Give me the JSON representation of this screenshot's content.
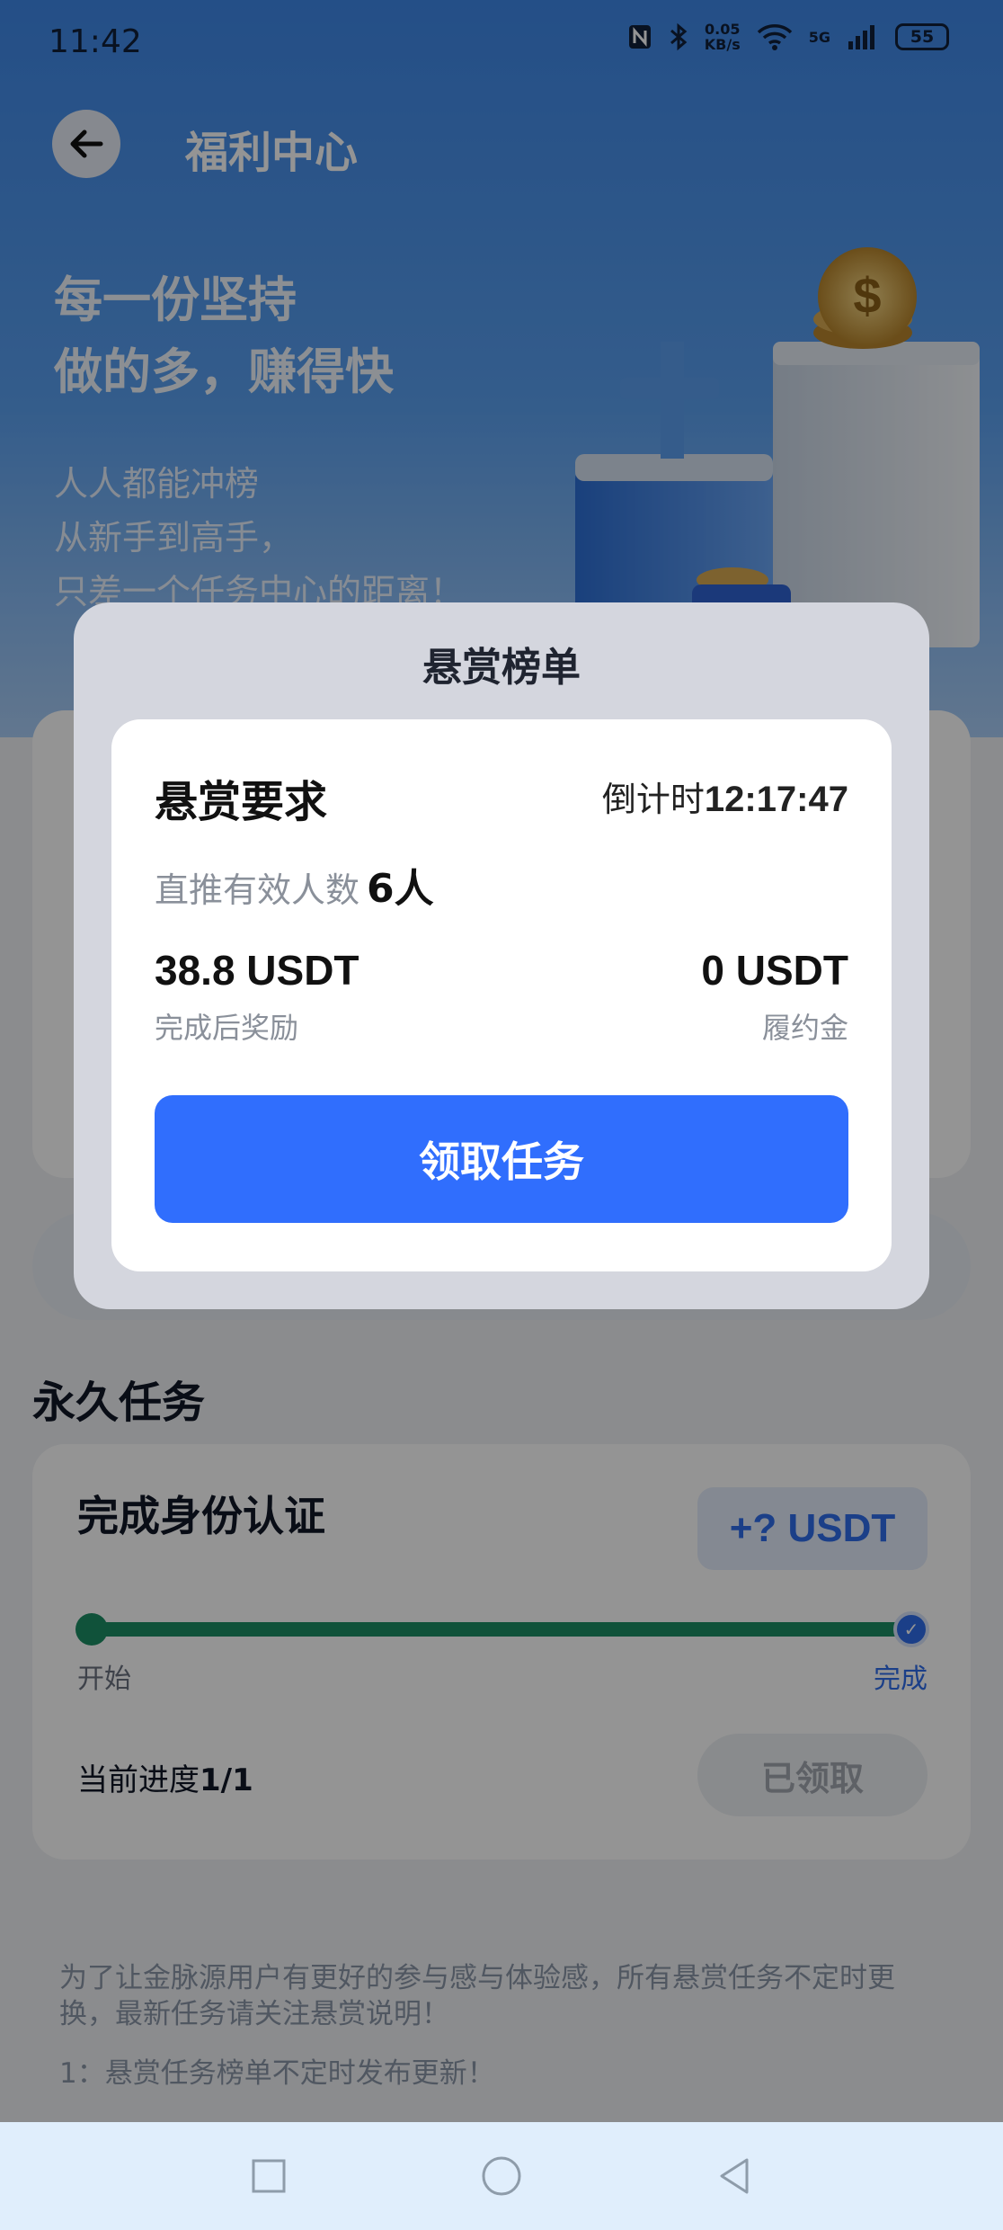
{
  "status_bar": {
    "time": "11:42",
    "net_speed_value": "0.05",
    "net_speed_unit": "KB/s",
    "network": "5G",
    "battery": "55"
  },
  "header": {
    "title": "福利中心",
    "back_icon": "arrow-left-icon"
  },
  "hero": {
    "headline_line1": "每一份坚持",
    "headline_line2": "做的多，赚得快",
    "sub_line1": "人人都能冲榜",
    "sub_line2": "从新手到高手，",
    "sub_line3": "只差一个任务中心的距离！"
  },
  "permanent_tasks": {
    "section_title": "永久任务",
    "task": {
      "name": "完成身份认证",
      "reward": "+? USDT",
      "progress_fraction": 1.0,
      "start_label": "开始",
      "end_label": "完成",
      "current_progress_label": "当前进度",
      "current_progress_value": "1/1",
      "button_label": "已领取"
    }
  },
  "notes": {
    "paragraph": "为了让金脉源用户有更好的参与感与体验感，所有悬赏任务不定时更换，最新任务请关注悬赏说明！",
    "item1": "1：悬赏任务榜单不定时发布更新！"
  },
  "modal": {
    "title": "悬赏榜单",
    "requirement_title": "悬赏要求",
    "countdown_label": "倒计时",
    "countdown_value": "12:17:47",
    "requirement_label": "直推有效人数",
    "requirement_value": "6人",
    "reward_value": "38.8 USDT",
    "reward_label": "完成后奖励",
    "deposit_value": "0 USDT",
    "deposit_label": "履约金",
    "claim_button": "领取任务"
  },
  "nav_bar": {
    "recent_icon": "square-recents-icon",
    "home_icon": "circle-home-icon",
    "back_icon": "triangle-back-icon"
  },
  "colors": {
    "primary_blue": "#306efd",
    "progress_green": "#1c8d64",
    "modal_bg": "#d4d6de"
  }
}
